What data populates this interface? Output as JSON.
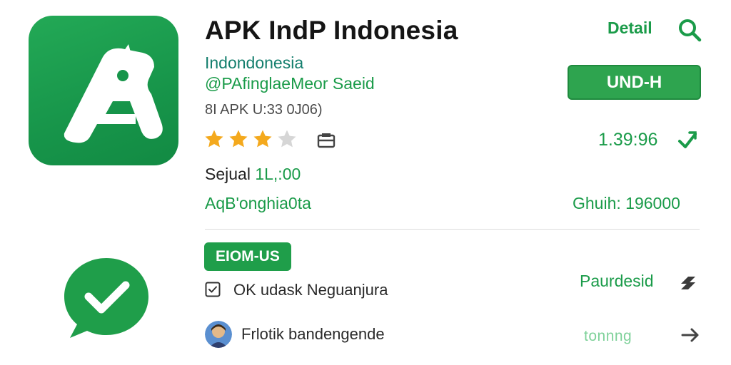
{
  "app": {
    "title": "APK IndP Indonesia",
    "developer": "Indondonesia",
    "publisher": "@PAfinglaeMeor Saeid",
    "meta": "8I APK U:33 0J06)",
    "rating_stars": 3,
    "rating_max": 5
  },
  "header": {
    "detail_label": "Detail",
    "install_label": "UND-H"
  },
  "stats": {
    "price": "1.39:96",
    "sejual_prefix": "Sejual ",
    "sejual_value": "1L,:00",
    "category": "AqB'onghia0ta",
    "size": "Ghuih: 196000"
  },
  "section": {
    "tag_label": "EIOM-US",
    "ok_text": "OK udask Neguanjura",
    "paurdesid": "Paurdesid",
    "reviewer": "Frlotik bandengende",
    "tonm": "tonnng"
  },
  "colors": {
    "brand_green": "#1a9b49",
    "icon_green": "#17954a",
    "star_gold": "#f4a91d"
  },
  "icons": [
    "app-logo-icon",
    "search-icon",
    "star-icon",
    "stats-icon",
    "share-icon",
    "check-icon",
    "checkbox-icon",
    "paurdesid-icon",
    "avatar",
    "arrow-right-icon"
  ]
}
